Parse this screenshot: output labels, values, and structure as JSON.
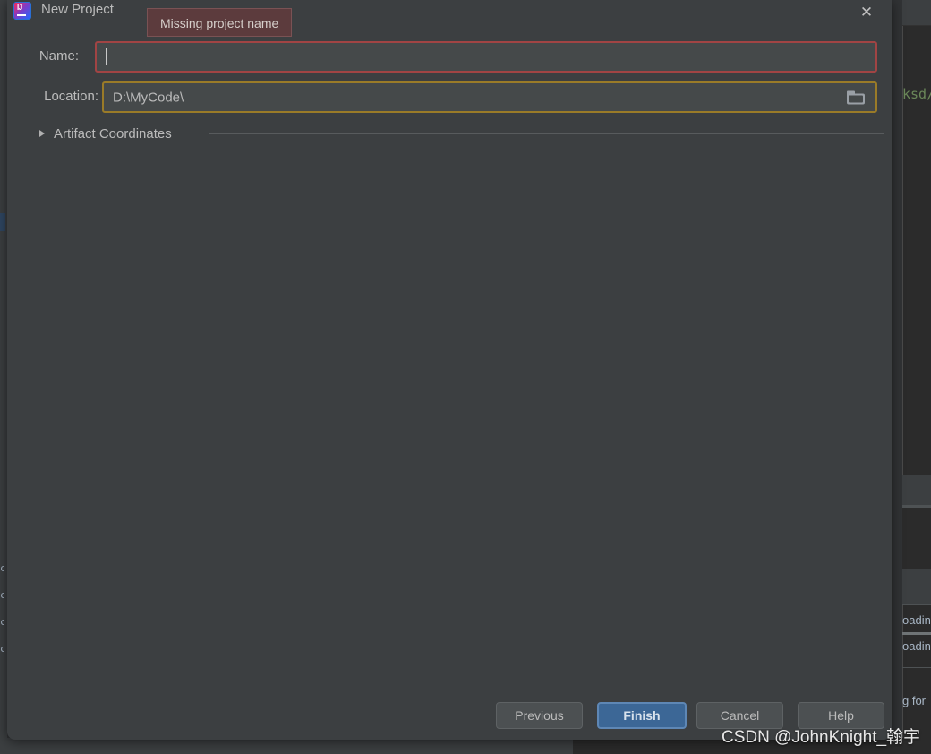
{
  "dialog": {
    "title": "New Project",
    "app_icon": "intellij-idea-icon",
    "icon_letters": "IJ",
    "close_label": "✕"
  },
  "validation": {
    "message": "Missing project name",
    "background": "#5c3b3d",
    "border": "#7a5254"
  },
  "form": {
    "name": {
      "label": "Name:",
      "value": "",
      "placeholder": "",
      "border_color": "#a14444",
      "has_caret": true
    },
    "location": {
      "label": "Location:",
      "value": "D:\\MyCode\\",
      "placeholder": "",
      "border_color": "#9a7b28",
      "browse_icon": "folder-icon"
    }
  },
  "section": {
    "label": "Artifact Coordinates",
    "expanded": false,
    "chevron": "triangle-right-icon"
  },
  "buttons": {
    "previous": "Previous",
    "finish": "Finish",
    "cancel": "Cancel",
    "help": "Help",
    "primary_color": "#3c6796"
  },
  "watermark": {
    "text": "CSDN @JohnKnight_翰宇"
  },
  "background_ide": {
    "editor_code_fragment": "ksd/",
    "log_fragment_1": "oading",
    "log_fragment_2": "oading",
    "log_fragment_3": "g for",
    "editor_bg": "#2b2b2b",
    "panel_bg": "#3c3f41",
    "code_color": "#6a8759"
  }
}
